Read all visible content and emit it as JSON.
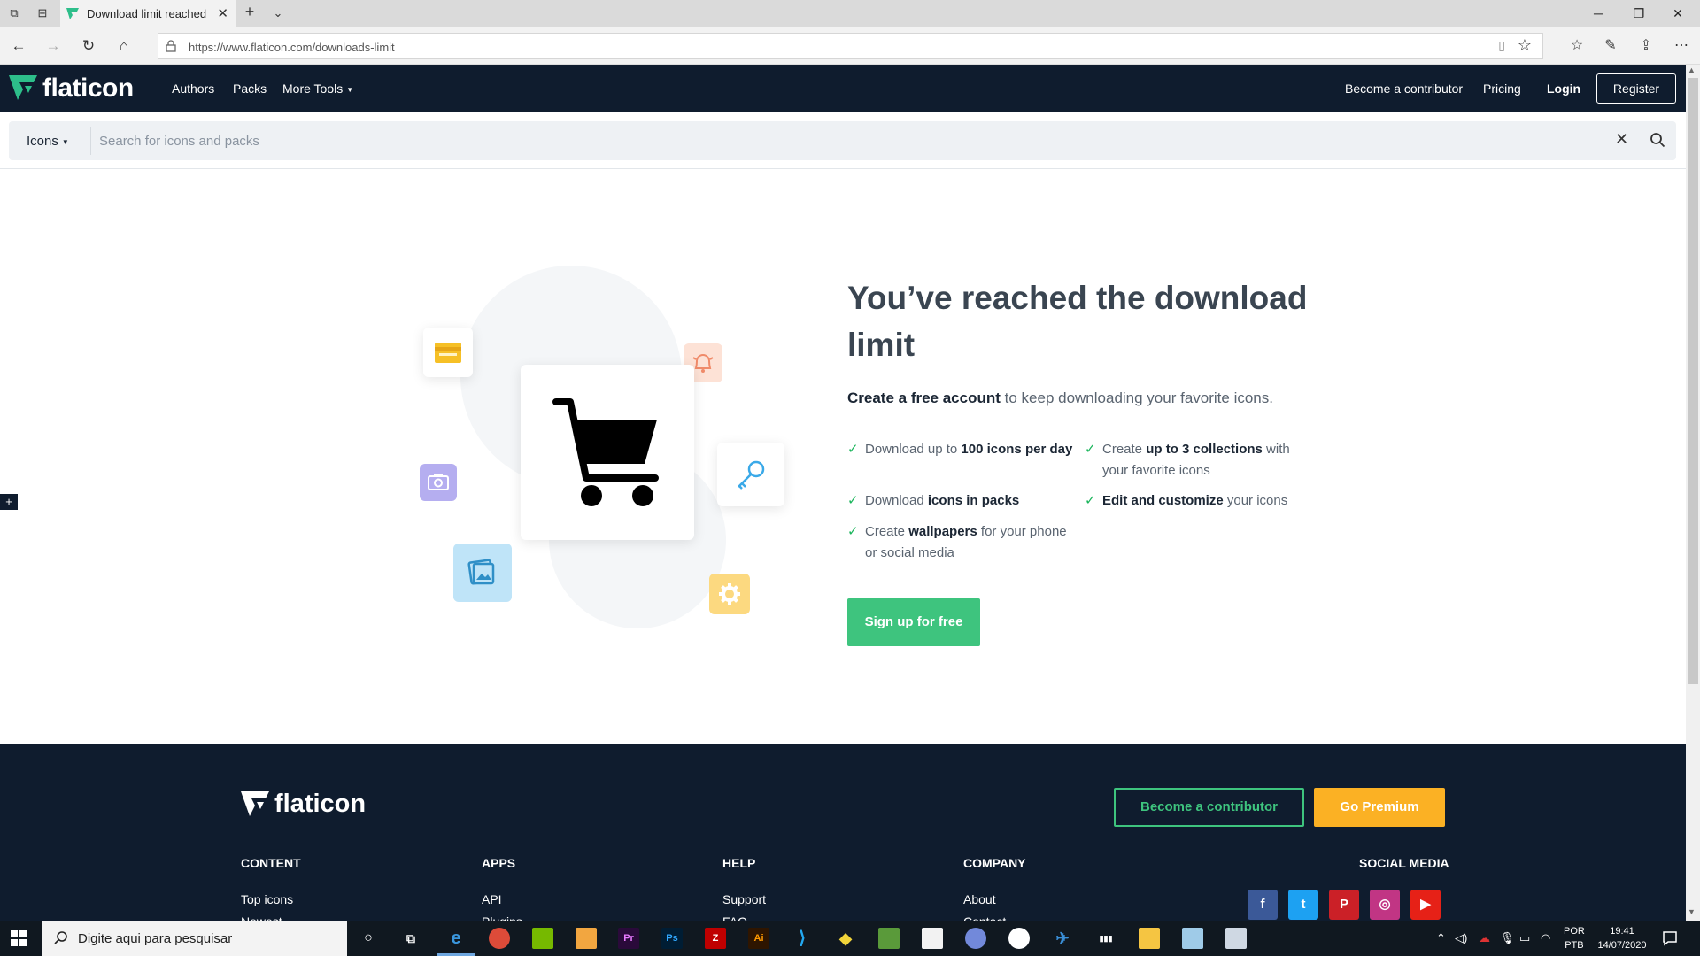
{
  "browser": {
    "tab_title": "Download limit reached",
    "url": "https://www.flaticon.com/downloads-limit"
  },
  "header": {
    "logo": "flaticon",
    "nav": [
      "Authors",
      "Packs",
      "More Tools"
    ],
    "contributor": "Become a contributor",
    "pricing": "Pricing",
    "login": "Login",
    "register": "Register"
  },
  "search": {
    "type": "Icons",
    "placeholder": "Search for icons and packs"
  },
  "main": {
    "title": "You’ve reached the download limit",
    "subtitle_bold": "Create a free account",
    "subtitle_rest": " to keep downloading your favorite icons.",
    "features": [
      {
        "pre": "Download up to ",
        "bold": "100 icons per day",
        "post": ""
      },
      {
        "pre": "Create ",
        "bold": "up to 3 collections",
        "post": " with your favorite icons"
      },
      {
        "pre": "Download ",
        "bold": "icons in packs",
        "post": ""
      },
      {
        "pre": "",
        "bold": "Edit and customize",
        "post": " your icons"
      },
      {
        "pre": "Create ",
        "bold": "wallpapers",
        "post": " for your phone or social media"
      }
    ],
    "signup": "Sign up for free"
  },
  "footer": {
    "logo": "flaticon",
    "contributor": "Become a contributor",
    "premium": "Go Premium",
    "columns": [
      {
        "heading": "CONTENT",
        "links": [
          "Top icons",
          "Newest"
        ]
      },
      {
        "heading": "APPS",
        "links": [
          "API",
          "Plugins"
        ]
      },
      {
        "heading": "HELP",
        "links": [
          "Support",
          "FAQ"
        ]
      },
      {
        "heading": "COMPANY",
        "links": [
          "About",
          "Contact"
        ]
      }
    ],
    "social_heading": "SOCIAL MEDIA",
    "social": [
      {
        "name": "facebook",
        "glyph": "f",
        "color": "#3b5998"
      },
      {
        "name": "twitter",
        "glyph": "t",
        "color": "#1da1f2"
      },
      {
        "name": "pinterest",
        "glyph": "P",
        "color": "#cb2027"
      },
      {
        "name": "instagram",
        "glyph": "◎",
        "color": "#c13584"
      },
      {
        "name": "youtube",
        "glyph": "▶",
        "color": "#e62117"
      }
    ]
  },
  "taskbar": {
    "search_placeholder": "Digite aqui para pesquisar",
    "lang_1": "POR",
    "lang_2": "PTB",
    "time": "19:41",
    "date": "14/07/2020"
  },
  "colors": {
    "brand_dark": "#0f1c2e",
    "brand_green": "#3ec47e",
    "premium_yellow": "#fbb124",
    "check_green": "#1bb55c"
  }
}
